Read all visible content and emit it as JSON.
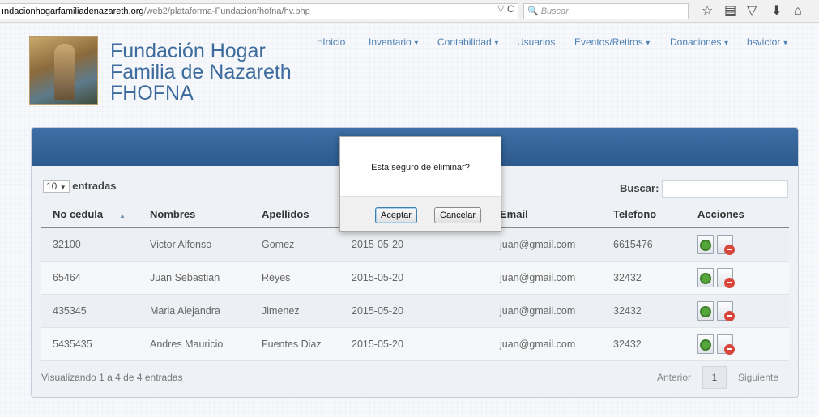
{
  "browser": {
    "url_domain": "ındacionhogarfamiliadenazareth.org",
    "url_path": "/web2/plataforma-Fundacionfhofna/hv.php",
    "search_placeholder": "Buscar",
    "search_icon_glyph": "🔍",
    "reload_glyph": "C",
    "dropdown_glyph": "▽"
  },
  "header": {
    "brand_line1": "Fundación Hogar",
    "brand_line2": "Familia de Nazareth",
    "brand_line3": "FHOFNA"
  },
  "nav": {
    "home": "Inicio",
    "inventario": "Inventario",
    "contabilidad": "Contabilidad",
    "usuarios": "Usuarios",
    "eventos": "Eventos/Retiros",
    "donaciones": "Donaciones",
    "user": "bsvictor"
  },
  "table_controls": {
    "length_value": "10",
    "length_label": "entradas",
    "search_label": "Buscar:"
  },
  "table": {
    "headers": [
      "No cedula",
      "Nombres",
      "Apellidos",
      "",
      "Email",
      "Telefono",
      "Acciones"
    ],
    "rows": [
      [
        "32100",
        "Victor Alfonso",
        "Gomez",
        "2015-05-20",
        "juan@gmail.com",
        "6615476"
      ],
      [
        "65464",
        "Juan Sebastian",
        "Reyes",
        "2015-05-20",
        "juan@gmail.com",
        "32432"
      ],
      [
        "435345",
        "Maria Alejandra",
        "Jimenez",
        "2015-05-20",
        "juan@gmail.com",
        "32432"
      ],
      [
        "5435435",
        "Andres Mauricio",
        "Fuentes Diaz",
        "2015-05-20",
        "juan@gmail.com",
        "32432"
      ]
    ]
  },
  "footer": {
    "info": "Visualizando 1 a 4 de 4 entradas",
    "prev": "Anterior",
    "page": "1",
    "next": "Siguiente"
  },
  "dialog": {
    "message": "Esta seguro de eliminar?",
    "accept": "Aceptar",
    "cancel": "Cancelar"
  },
  "colors": {
    "panel_header": "#2d5a8d",
    "brand": "#3d6b9d",
    "nav_link": "#4f80b4"
  }
}
